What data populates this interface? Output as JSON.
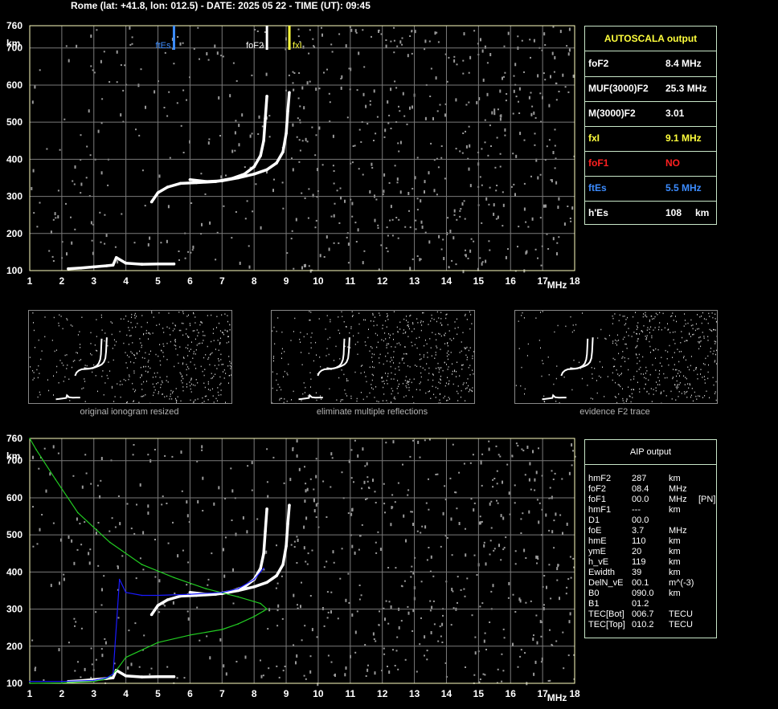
{
  "header": {
    "text": "Rome (lat: +41.8, lon: 012.5) - DATE: 2025 05 22 - TIME (UT): 09:45"
  },
  "colors": {
    "frame": "#ffffc0",
    "grid": "#7a7a7a",
    "trace": "#ffffff",
    "fxI": "#ffff3c",
    "fbEs": "#3c8cff",
    "foF1": "#ff2020",
    "profile": "#22cc22",
    "aip_trace": "#1a1aff"
  },
  "chart_data": [
    {
      "type": "scatter",
      "title": "",
      "xlabel": "MHz",
      "ylabel": "km",
      "xlim": [
        1,
        18
      ],
      "ylim": [
        100,
        760
      ],
      "x_ticks": [
        "1",
        "2",
        "3",
        "4",
        "5",
        "6",
        "7",
        "8",
        "9",
        "10",
        "11",
        "12",
        "13",
        "14",
        "15",
        "16",
        "17",
        "18"
      ],
      "y_ticks": [
        "100",
        "200",
        "300",
        "400",
        "500",
        "600",
        "700",
        "760"
      ],
      "grid": true,
      "markers": [
        {
          "name": "ftEs",
          "x": 5.5,
          "color": "#3c8cff"
        },
        {
          "name": "foF2",
          "x": 8.4,
          "color": "#ffffff"
        },
        {
          "name": "fxI",
          "x": 9.1,
          "color": "#ffff3c"
        }
      ],
      "series": [
        {
          "name": "ordinary trace",
          "x": [
            4.8,
            5.0,
            5.3,
            5.7,
            6.2,
            6.8,
            7.3,
            7.7,
            8.0,
            8.2,
            8.3,
            8.35,
            8.4
          ],
          "y": [
            285,
            310,
            325,
            335,
            337,
            340,
            348,
            360,
            380,
            410,
            450,
            510,
            570
          ]
        },
        {
          "name": "extraordinary trace",
          "x": [
            6.0,
            6.5,
            7.0,
            7.5,
            8.0,
            8.4,
            8.7,
            8.9,
            9.0,
            9.05,
            9.1
          ],
          "y": [
            345,
            340,
            342,
            350,
            360,
            372,
            390,
            420,
            470,
            530,
            580
          ]
        },
        {
          "name": "Es trace",
          "x": [
            2.2,
            2.6,
            3.0,
            3.4,
            3.6,
            3.7,
            4.0,
            4.5,
            5.0,
            5.5
          ],
          "y": [
            105,
            107,
            110,
            113,
            115,
            135,
            120,
            117,
            118,
            118
          ]
        }
      ]
    },
    {
      "type": "line",
      "title": "",
      "xlabel": "MHz",
      "ylabel": "km",
      "xlim": [
        1,
        18
      ],
      "ylim": [
        100,
        760
      ],
      "x_ticks": [
        "1",
        "2",
        "3",
        "4",
        "5",
        "6",
        "7",
        "8",
        "9",
        "10",
        "11",
        "12",
        "13",
        "14",
        "15",
        "16",
        "17",
        "18"
      ],
      "y_ticks": [
        "100",
        "200",
        "300",
        "400",
        "500",
        "600",
        "700",
        "760"
      ],
      "grid": true,
      "series": [
        {
          "name": "electron density profile",
          "x": [
            1.0,
            2.0,
            3.0,
            3.3,
            3.5,
            3.7,
            4.0,
            5.0,
            6.0,
            7.0,
            7.5,
            8.0,
            8.3,
            8.4,
            8.2,
            7.5,
            6.5,
            5.5,
            4.5,
            3.5,
            2.5,
            1.8,
            1.2,
            1.0
          ],
          "y": [
            100,
            101,
            105,
            110,
            118,
            135,
            170,
            210,
            230,
            245,
            260,
            280,
            295,
            300,
            315,
            333,
            355,
            385,
            420,
            480,
            560,
            650,
            730,
            760
          ]
        },
        {
          "name": "recomputed trace",
          "x": [
            1.0,
            2.0,
            3.0,
            3.4,
            3.6,
            3.8,
            4.0,
            4.5,
            5.0,
            6.0,
            7.0,
            7.5,
            8.0,
            8.3
          ],
          "y": [
            105,
            105,
            108,
            115,
            125,
            380,
            345,
            337,
            337,
            340,
            345,
            355,
            380,
            410
          ]
        }
      ]
    }
  ],
  "autoscala": {
    "title": "AUTOSCALA output",
    "rows": [
      {
        "label": "foF2",
        "value": "8.4 MHz",
        "unit": "",
        "color": "#ffffff"
      },
      {
        "label": "MUF(3000)F2",
        "value": "25.3 MHz",
        "unit": "",
        "color": "#ffffff"
      },
      {
        "label": "M(3000)F2",
        "value": "3.01",
        "unit": "",
        "color": "#ffffff"
      },
      {
        "label": "fxI",
        "value": "9.1 MHz",
        "unit": "",
        "color": "#ffff3c"
      },
      {
        "label": "foF1",
        "value": "NO",
        "unit": "",
        "color": "#ff2020"
      },
      {
        "label": "ftEs",
        "value": "5.5 MHz",
        "unit": "",
        "color": "#3c8cff"
      },
      {
        "label": "h'Es",
        "value": "108",
        "unit": "km",
        "color": "#ffffff"
      }
    ]
  },
  "thumbnails": [
    {
      "caption": "original ionogram resized"
    },
    {
      "caption": "eliminate multiple reflections"
    },
    {
      "caption": "evidence F2 trace"
    }
  ],
  "aip": {
    "title": "AIP output",
    "rows": [
      {
        "label": "hmF2",
        "value": "287",
        "unit": "km",
        "extra": ""
      },
      {
        "label": "foF2",
        "value": "08.4",
        "unit": "MHz",
        "extra": ""
      },
      {
        "label": "foF1",
        "value": "00.0",
        "unit": "MHz",
        "extra": "[PN]"
      },
      {
        "label": "hmF1",
        "value": "---",
        "unit": "km",
        "extra": ""
      },
      {
        "label": "D1",
        "value": "00.0",
        "unit": "",
        "extra": ""
      },
      {
        "label": "foE",
        "value": "3.7",
        "unit": "MHz",
        "extra": ""
      },
      {
        "label": "hmE",
        "value": "110",
        "unit": "km",
        "extra": ""
      },
      {
        "label": "ymE",
        "value": "20",
        "unit": "km",
        "extra": ""
      },
      {
        "label": "h_vE",
        "value": "119",
        "unit": "km",
        "extra": ""
      },
      {
        "label": "Ewidth",
        "value": "39",
        "unit": "km",
        "extra": ""
      },
      {
        "label": "DelN_vE",
        "value": "00.1",
        "unit": "m^(-3)",
        "extra": ""
      },
      {
        "label": "B0",
        "value": "090.0",
        "unit": "km",
        "extra": ""
      },
      {
        "label": "B1",
        "value": "01.2",
        "unit": "",
        "extra": ""
      },
      {
        "label": "TEC[Bot]",
        "value": "006.7",
        "unit": "TECU",
        "extra": ""
      },
      {
        "label": "TEC[Top]",
        "value": "010.2",
        "unit": "TECU",
        "extra": ""
      }
    ]
  }
}
